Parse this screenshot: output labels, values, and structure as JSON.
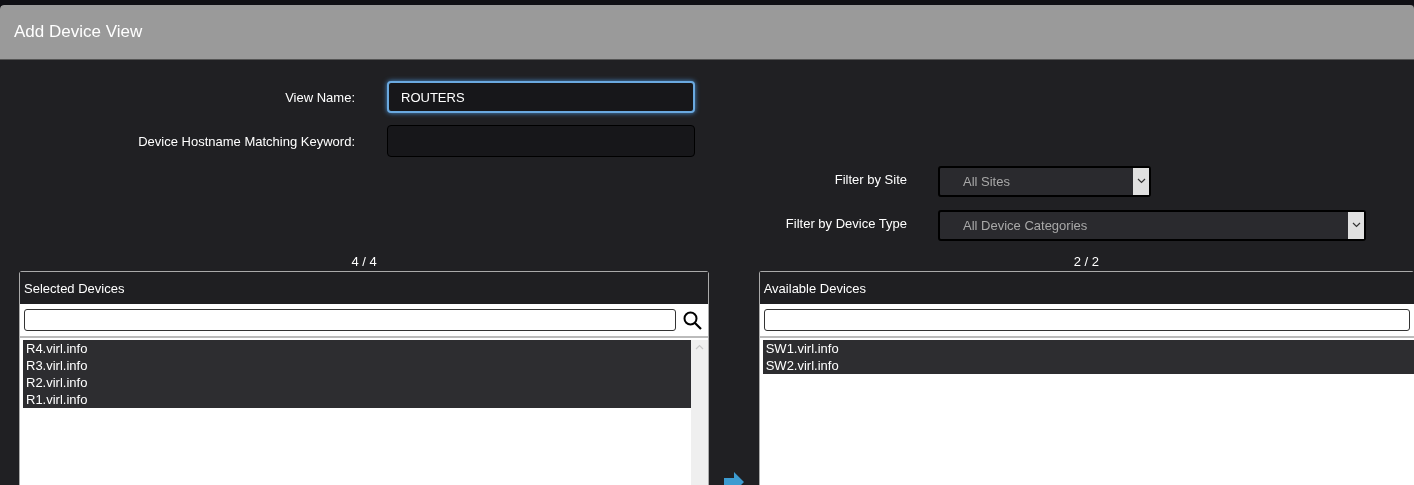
{
  "dialog": {
    "title": "Add Device View"
  },
  "fields": [
    {
      "label": "View Name:",
      "value": "ROUTERS",
      "focused": true
    },
    {
      "label": "Device Hostname Matching Keyword:",
      "focused": false
    }
  ],
  "filters": [
    {
      "label": "Filter by Site",
      "value": "All Sites"
    },
    {
      "label": "Filter by Device Type",
      "value": "All Device Categories"
    }
  ],
  "panels": [
    {
      "count": "4 / 4",
      "title": "Selected Devices",
      "search_icon": true,
      "items": [
        {
          "label": "R4.virl.info",
          "selected": true
        },
        {
          "label": "R3.virl.info",
          "selected": true
        },
        {
          "label": "R2.virl.info",
          "selected": true
        },
        {
          "label": "R1.virl.info",
          "selected": true
        }
      ]
    },
    {
      "count": "2 / 2",
      "title": "Available Devices",
      "search_icon": false,
      "items": [
        {
          "label": "SW1.virl.info",
          "selected": true
        },
        {
          "label": "SW2.virl.info",
          "selected": true
        }
      ]
    }
  ]
}
